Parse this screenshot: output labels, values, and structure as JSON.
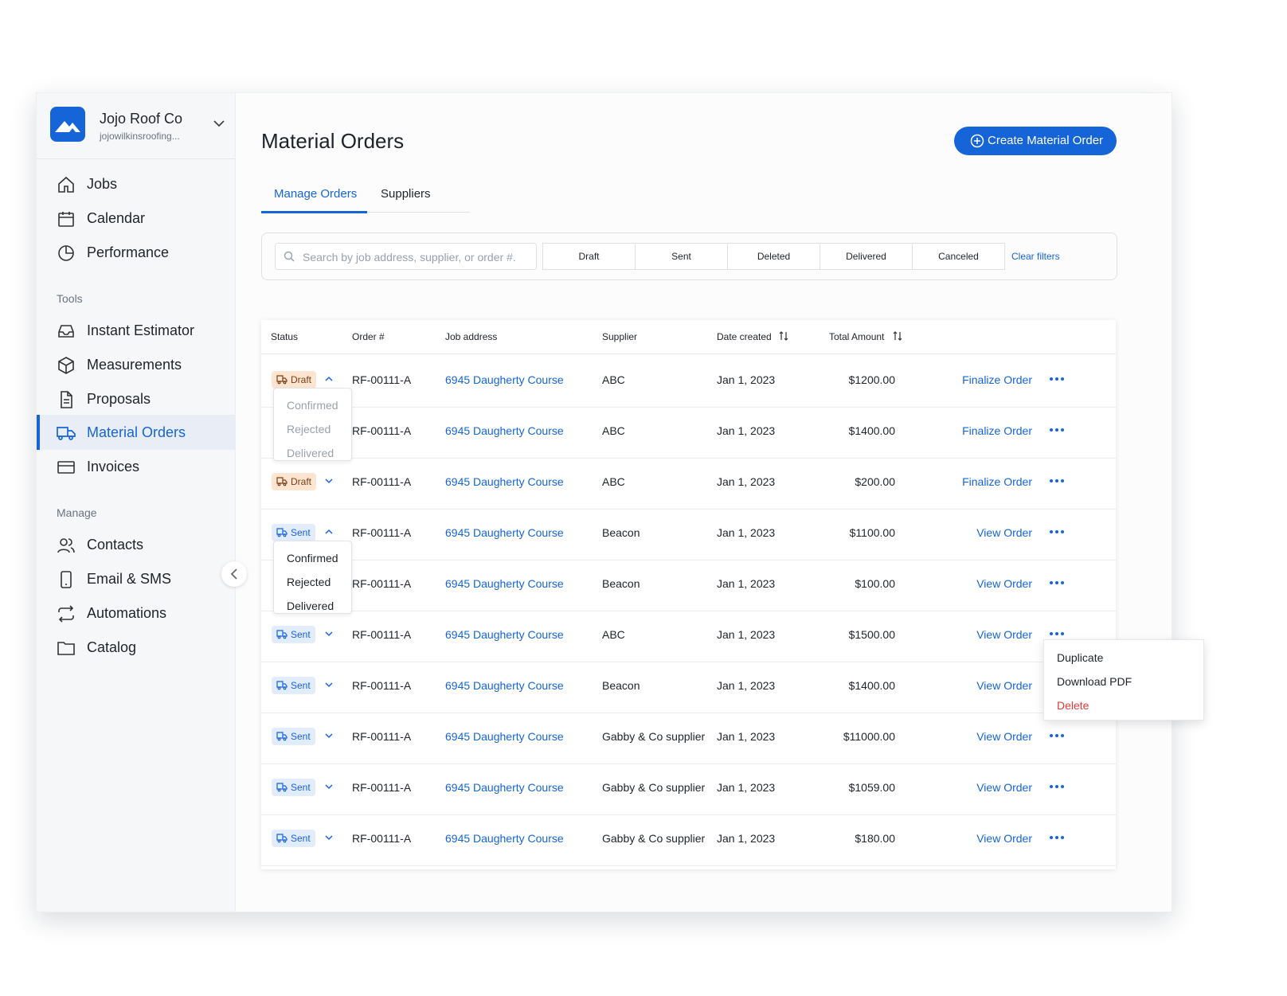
{
  "company": {
    "name": "Jojo Roof Co",
    "subtitle": "jojowilkinsroofing..."
  },
  "nav": {
    "primary": [
      {
        "label": "Jobs",
        "icon": "home-icon"
      },
      {
        "label": "Calendar",
        "icon": "calendar-icon"
      },
      {
        "label": "Performance",
        "icon": "pie-chart-icon"
      }
    ],
    "tools_label": "Tools",
    "tools": [
      {
        "label": "Instant Estimator",
        "icon": "inbox-icon"
      },
      {
        "label": "Measurements",
        "icon": "cube-icon"
      },
      {
        "label": "Proposals",
        "icon": "document-icon"
      },
      {
        "label": "Material Orders",
        "icon": "truck-icon",
        "active": true
      },
      {
        "label": "Invoices",
        "icon": "credit-card-icon"
      }
    ],
    "manage_label": "Manage",
    "manage": [
      {
        "label": "Contacts",
        "icon": "users-icon"
      },
      {
        "label": "Email & SMS",
        "icon": "phone-icon"
      },
      {
        "label": "Automations",
        "icon": "repeat-icon"
      },
      {
        "label": "Catalog",
        "icon": "folder-icon"
      }
    ]
  },
  "page": {
    "title": "Material Orders",
    "create_button": "Create Material Order",
    "tabs": [
      {
        "label": "Manage Orders",
        "active": true
      },
      {
        "label": "Suppliers"
      }
    ]
  },
  "filters": {
    "search_placeholder": "Search by job address, supplier, or order #.",
    "chips": [
      "Draft",
      "Sent",
      "Deleted",
      "Delivered",
      "Canceled"
    ],
    "clear": "Clear filters"
  },
  "table": {
    "headers": [
      "Status",
      "Order #",
      "Job address",
      "Supplier",
      "Date created",
      "Total Amount"
    ],
    "rows": [
      {
        "status": "Draft",
        "order": "RF-00111-A",
        "address": "6945 Daugherty Course",
        "supplier": "ABC",
        "date": "Jan 1, 2023",
        "amount": "$1200.00",
        "action": "Finalize Order"
      },
      {
        "status": "",
        "order": "RF-00111-A",
        "address": "6945 Daugherty Course",
        "supplier": "ABC",
        "date": "Jan 1, 2023",
        "amount": "$1400.00",
        "action": "Finalize Order"
      },
      {
        "status": "Draft",
        "order": "RF-00111-A",
        "address": "6945 Daugherty Course",
        "supplier": "ABC",
        "date": "Jan 1, 2023",
        "amount": "$200.00",
        "action": "Finalize Order"
      },
      {
        "status": "Sent",
        "order": "RF-00111-A",
        "address": "6945 Daugherty Course",
        "supplier": "Beacon",
        "date": "Jan 1, 2023",
        "amount": "$1100.00",
        "action": "View Order"
      },
      {
        "status": "",
        "order": "RF-00111-A",
        "address": "6945 Daugherty Course",
        "supplier": "Beacon",
        "date": "Jan 1, 2023",
        "amount": "$100.00",
        "action": "View Order"
      },
      {
        "status": "Sent",
        "order": "RF-00111-A",
        "address": "6945 Daugherty Course",
        "supplier": "ABC",
        "date": "Jan 1, 2023",
        "amount": "$1500.00",
        "action": "View Order"
      },
      {
        "status": "Sent",
        "order": "RF-00111-A",
        "address": "6945 Daugherty Course",
        "supplier": "Beacon",
        "date": "Jan 1, 2023",
        "amount": "$1400.00",
        "action": "View Order"
      },
      {
        "status": "Sent",
        "order": "RF-00111-A",
        "address": "6945 Daugherty Course",
        "supplier": "Gabby & Co supplier",
        "date": "Jan 1, 2023",
        "amount": "$11000.00",
        "action": "View Order"
      },
      {
        "status": "Sent",
        "order": "RF-00111-A",
        "address": "6945 Daugherty Course",
        "supplier": "Gabby & Co supplier",
        "date": "Jan 1, 2023",
        "amount": "$1059.00",
        "action": "View Order"
      },
      {
        "status": "Sent",
        "order": "RF-00111-A",
        "address": "6945 Daugherty Course",
        "supplier": "Gabby & Co supplier",
        "date": "Jan 1, 2023",
        "amount": "$180.00",
        "action": "View Order"
      }
    ]
  },
  "status_menu": {
    "options": [
      "Confirmed",
      "Rejected",
      "Delivered"
    ]
  },
  "row_menu": {
    "options": [
      "Duplicate",
      "Download PDF",
      "Delete"
    ]
  },
  "colors": {
    "accent": "#1565d8",
    "draft_bg": "#fde5d2",
    "sent_bg": "#e3ecfb",
    "danger": "#e23a3a"
  }
}
